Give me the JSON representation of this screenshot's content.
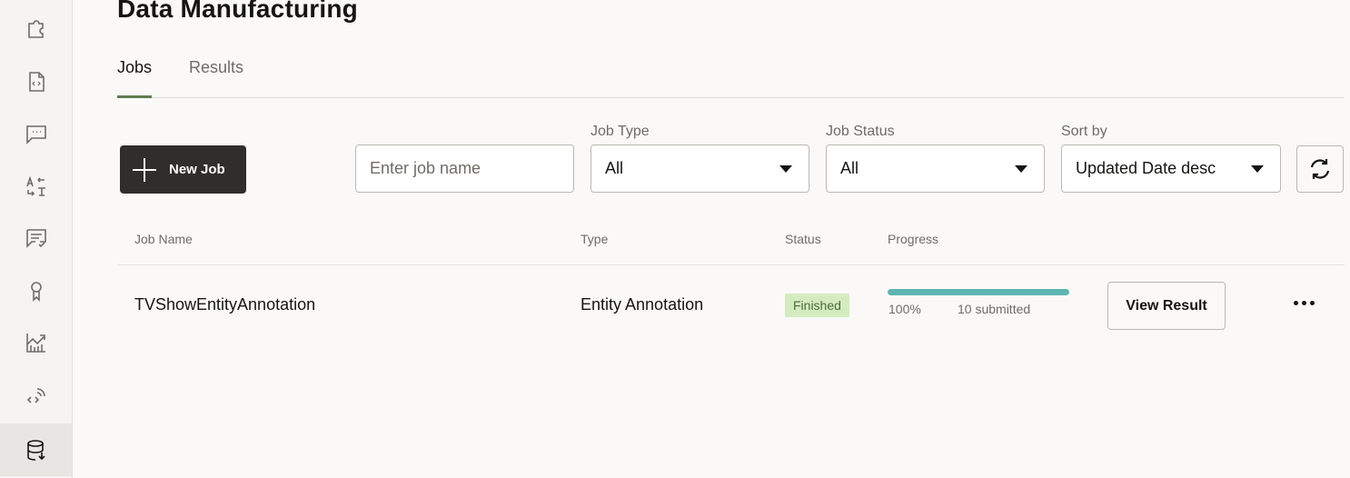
{
  "sidebar": {
    "items": [
      {
        "icon": "puzzle-icon",
        "active": false
      },
      {
        "icon": "code-file-icon",
        "active": false
      },
      {
        "icon": "chat-icon",
        "active": false
      },
      {
        "icon": "translate-icon",
        "active": false
      },
      {
        "icon": "feedback-icon",
        "active": false
      },
      {
        "icon": "award-icon",
        "active": false
      },
      {
        "icon": "chart-icon",
        "active": false
      },
      {
        "icon": "api-icon",
        "active": false
      },
      {
        "icon": "database-download-icon",
        "active": true
      }
    ]
  },
  "header": {
    "title": "Data Manufacturing"
  },
  "tabs": [
    {
      "label": "Jobs",
      "active": true
    },
    {
      "label": "Results",
      "active": false
    }
  ],
  "toolbar": {
    "new_job_label": "New Job",
    "search": {
      "placeholder": "Enter job name",
      "value": ""
    },
    "job_type": {
      "label": "Job Type",
      "value": "All"
    },
    "job_status": {
      "label": "Job Status",
      "value": "All"
    },
    "sort_by": {
      "label": "Sort by",
      "value": "Updated Date desc"
    },
    "refresh_icon": "refresh-icon"
  },
  "table": {
    "columns": [
      "Job Name",
      "Type",
      "Status",
      "Progress"
    ],
    "rows": [
      {
        "job_name": "TVShowEntityAnnotation",
        "type": "Entity Annotation",
        "status": "Finished",
        "progress_percent": 100,
        "progress_label": "100%",
        "submitted_label": "10 submitted",
        "action_label": "View Result"
      }
    ]
  },
  "colors": {
    "accent_tab": "#5f7d4f",
    "primary_button": "#312d2a",
    "status_finished_bg": "#d4ebc0",
    "progress_fill": "#5fb5b0"
  }
}
